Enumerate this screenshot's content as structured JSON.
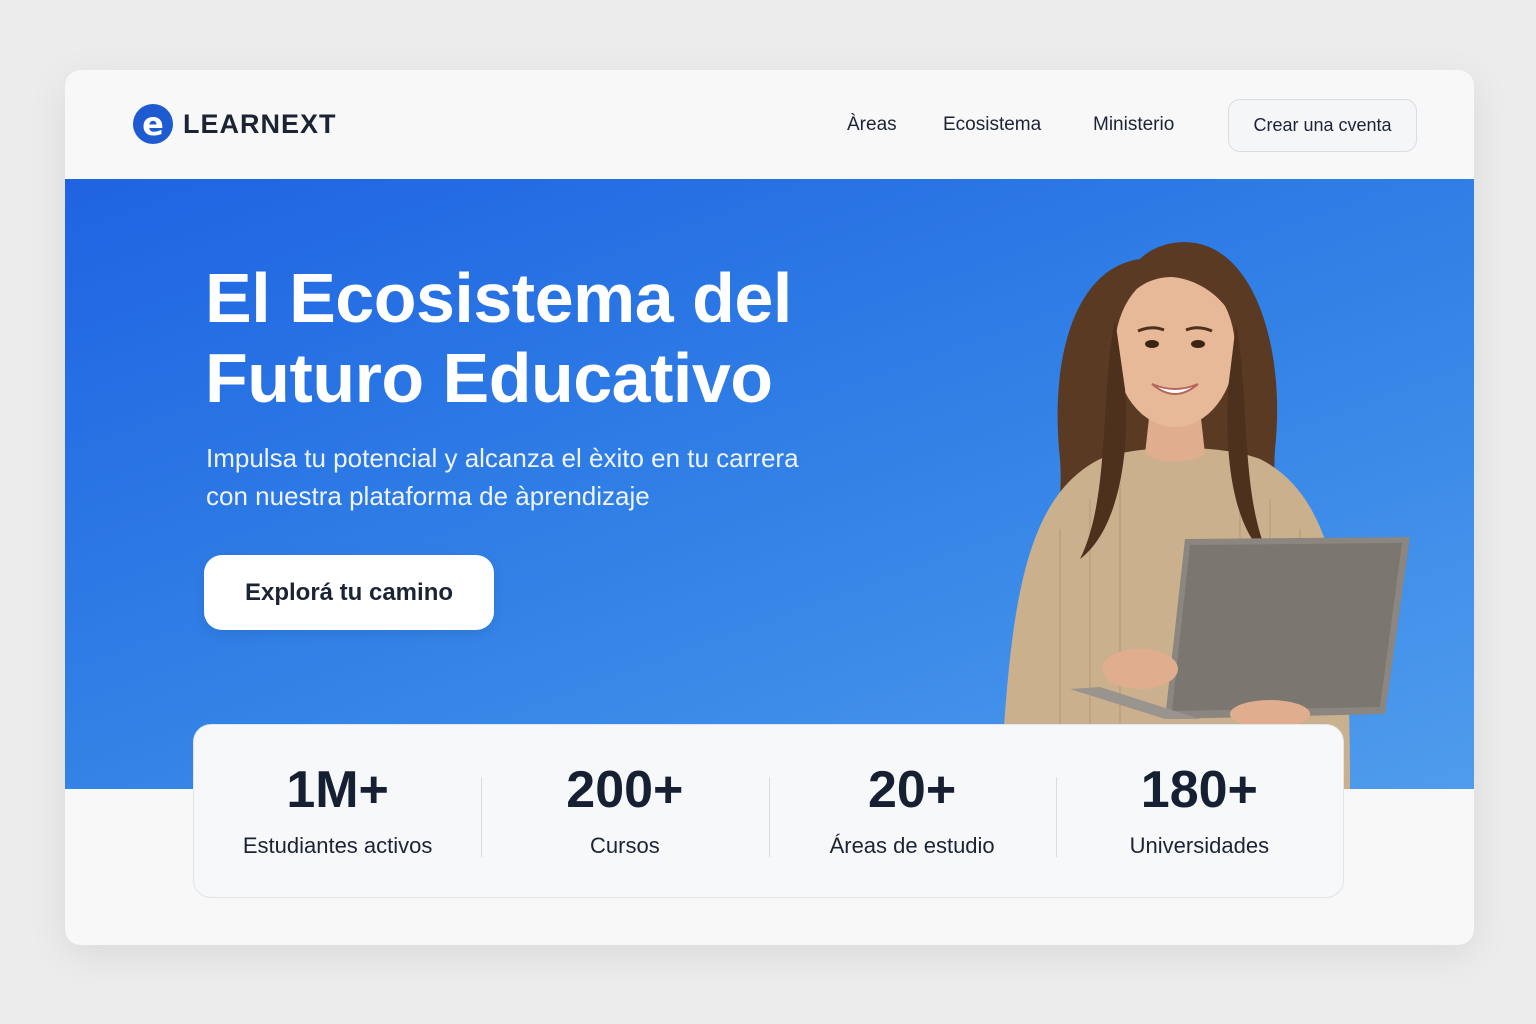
{
  "brand": {
    "logo_letter": "e",
    "name": "LEARNEXT",
    "color": "#1f5bd0"
  },
  "nav": {
    "items": [
      {
        "label": "Àreas"
      },
      {
        "label": "Ecosistema"
      },
      {
        "label": "Ministerio"
      }
    ],
    "cta_label": "Crear una cventa"
  },
  "hero": {
    "title_line1": "El Ecosistema del",
    "title_line2": "Futuro Educativo",
    "subtitle_line1": "Impulsa tu potencial y alcanza el èxito en tu carrera",
    "subtitle_line2": "con nuestra plataforma de àprendizaje",
    "cta_label": "Explorá tu camino",
    "background": "#2a74e4",
    "image": "woman-with-laptop"
  },
  "stats": [
    {
      "value": "1M+",
      "label": "Estudiantes activos"
    },
    {
      "value": "200+",
      "label": "Cursos"
    },
    {
      "value": "20+",
      "label": "Áreas de estudio"
    },
    {
      "value": "180+",
      "label": "Universidades"
    }
  ]
}
